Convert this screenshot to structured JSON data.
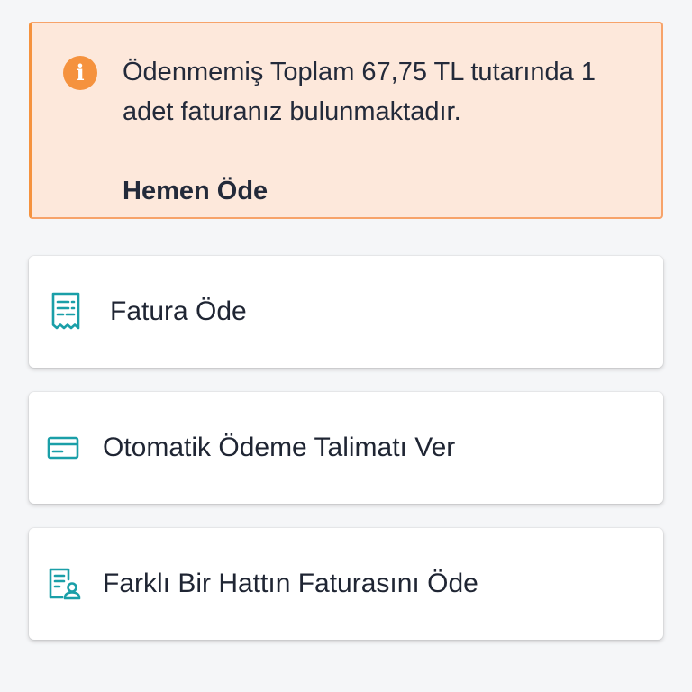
{
  "alert": {
    "icon": "info-icon",
    "icon_glyph": "i",
    "message": "Ödenmemiş Toplam 67,75 TL tutarında 1 adet faturanız bulunmaktadır.",
    "action_label": "Hemen Öde",
    "accent_color": "#f5923e",
    "background_color": "#fde8db"
  },
  "menu": {
    "icon_color": "#1a9fa8",
    "items": [
      {
        "label": "Fatura Öde",
        "icon": "receipt-icon"
      },
      {
        "label": "Otomatik Ödeme Talimatı Ver",
        "icon": "credit-card-icon"
      },
      {
        "label": "Farklı Bir Hattın Faturasını Öde",
        "icon": "invoice-person-icon"
      }
    ]
  }
}
